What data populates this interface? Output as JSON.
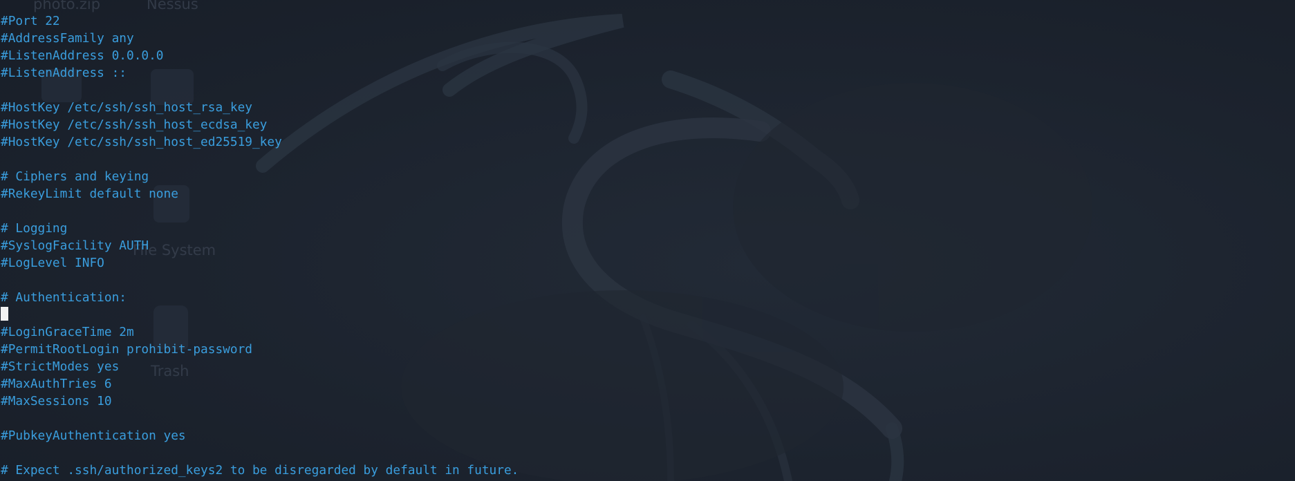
{
  "desktop": {
    "icons": [
      {
        "label": "photo.zip",
        "icon": "file-zip-icon"
      },
      {
        "label": "Nessus",
        "icon": "app-icon"
      },
      {
        "label": "File System",
        "icon": "drive-icon"
      },
      {
        "label": "Trash",
        "icon": "trash-icon"
      }
    ],
    "wallpaper": "kali-dragon-logo"
  },
  "terminal": {
    "text_color": "#3a9ede",
    "background": "#1b222d",
    "lines": [
      "#Port 22",
      "#AddressFamily any",
      "#ListenAddress 0.0.0.0",
      "#ListenAddress ::",
      "",
      "#HostKey /etc/ssh/ssh_host_rsa_key",
      "#HostKey /etc/ssh/ssh_host_ecdsa_key",
      "#HostKey /etc/ssh/ssh_host_ed25519_key",
      "",
      "# Ciphers and keying",
      "#RekeyLimit default none",
      "",
      "# Logging",
      "#SyslogFacility AUTH",
      "#LogLevel INFO",
      "",
      "# Authentication:",
      "",
      "#LoginGraceTime 2m",
      "#PermitRootLogin prohibit-password",
      "#StrictModes yes",
      "#MaxAuthTries 6",
      "#MaxSessions 10",
      "",
      "#PubkeyAuthentication yes",
      "",
      "# Expect .ssh/authorized_keys2 to be disregarded by default in future."
    ]
  }
}
